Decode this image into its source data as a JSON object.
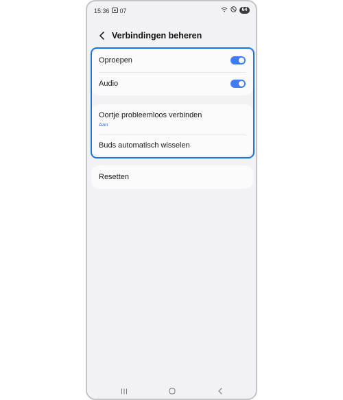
{
  "status_bar": {
    "time": "15:36",
    "notification_text": "07",
    "battery_level": "64"
  },
  "header": {
    "title": "Verbindingen beheren"
  },
  "group1": {
    "items": [
      {
        "label": "Oproepen",
        "toggle_on": true
      },
      {
        "label": "Audio",
        "toggle_on": true
      }
    ]
  },
  "group2": {
    "items": [
      {
        "label": "Oortje probleemloos verbinden",
        "subtitle": "Aan"
      },
      {
        "label": "Buds automatisch wisselen"
      }
    ]
  },
  "group3": {
    "items": [
      {
        "label": "Resetten"
      }
    ]
  },
  "colors": {
    "accent": "#3e7bf5",
    "highlight": "#1b74d9",
    "background": "#f2f2f4"
  },
  "icons": {
    "back": "chevron-left-icon",
    "nav_recents": "recents-icon",
    "nav_home": "home-icon",
    "nav_back": "back-icon"
  }
}
